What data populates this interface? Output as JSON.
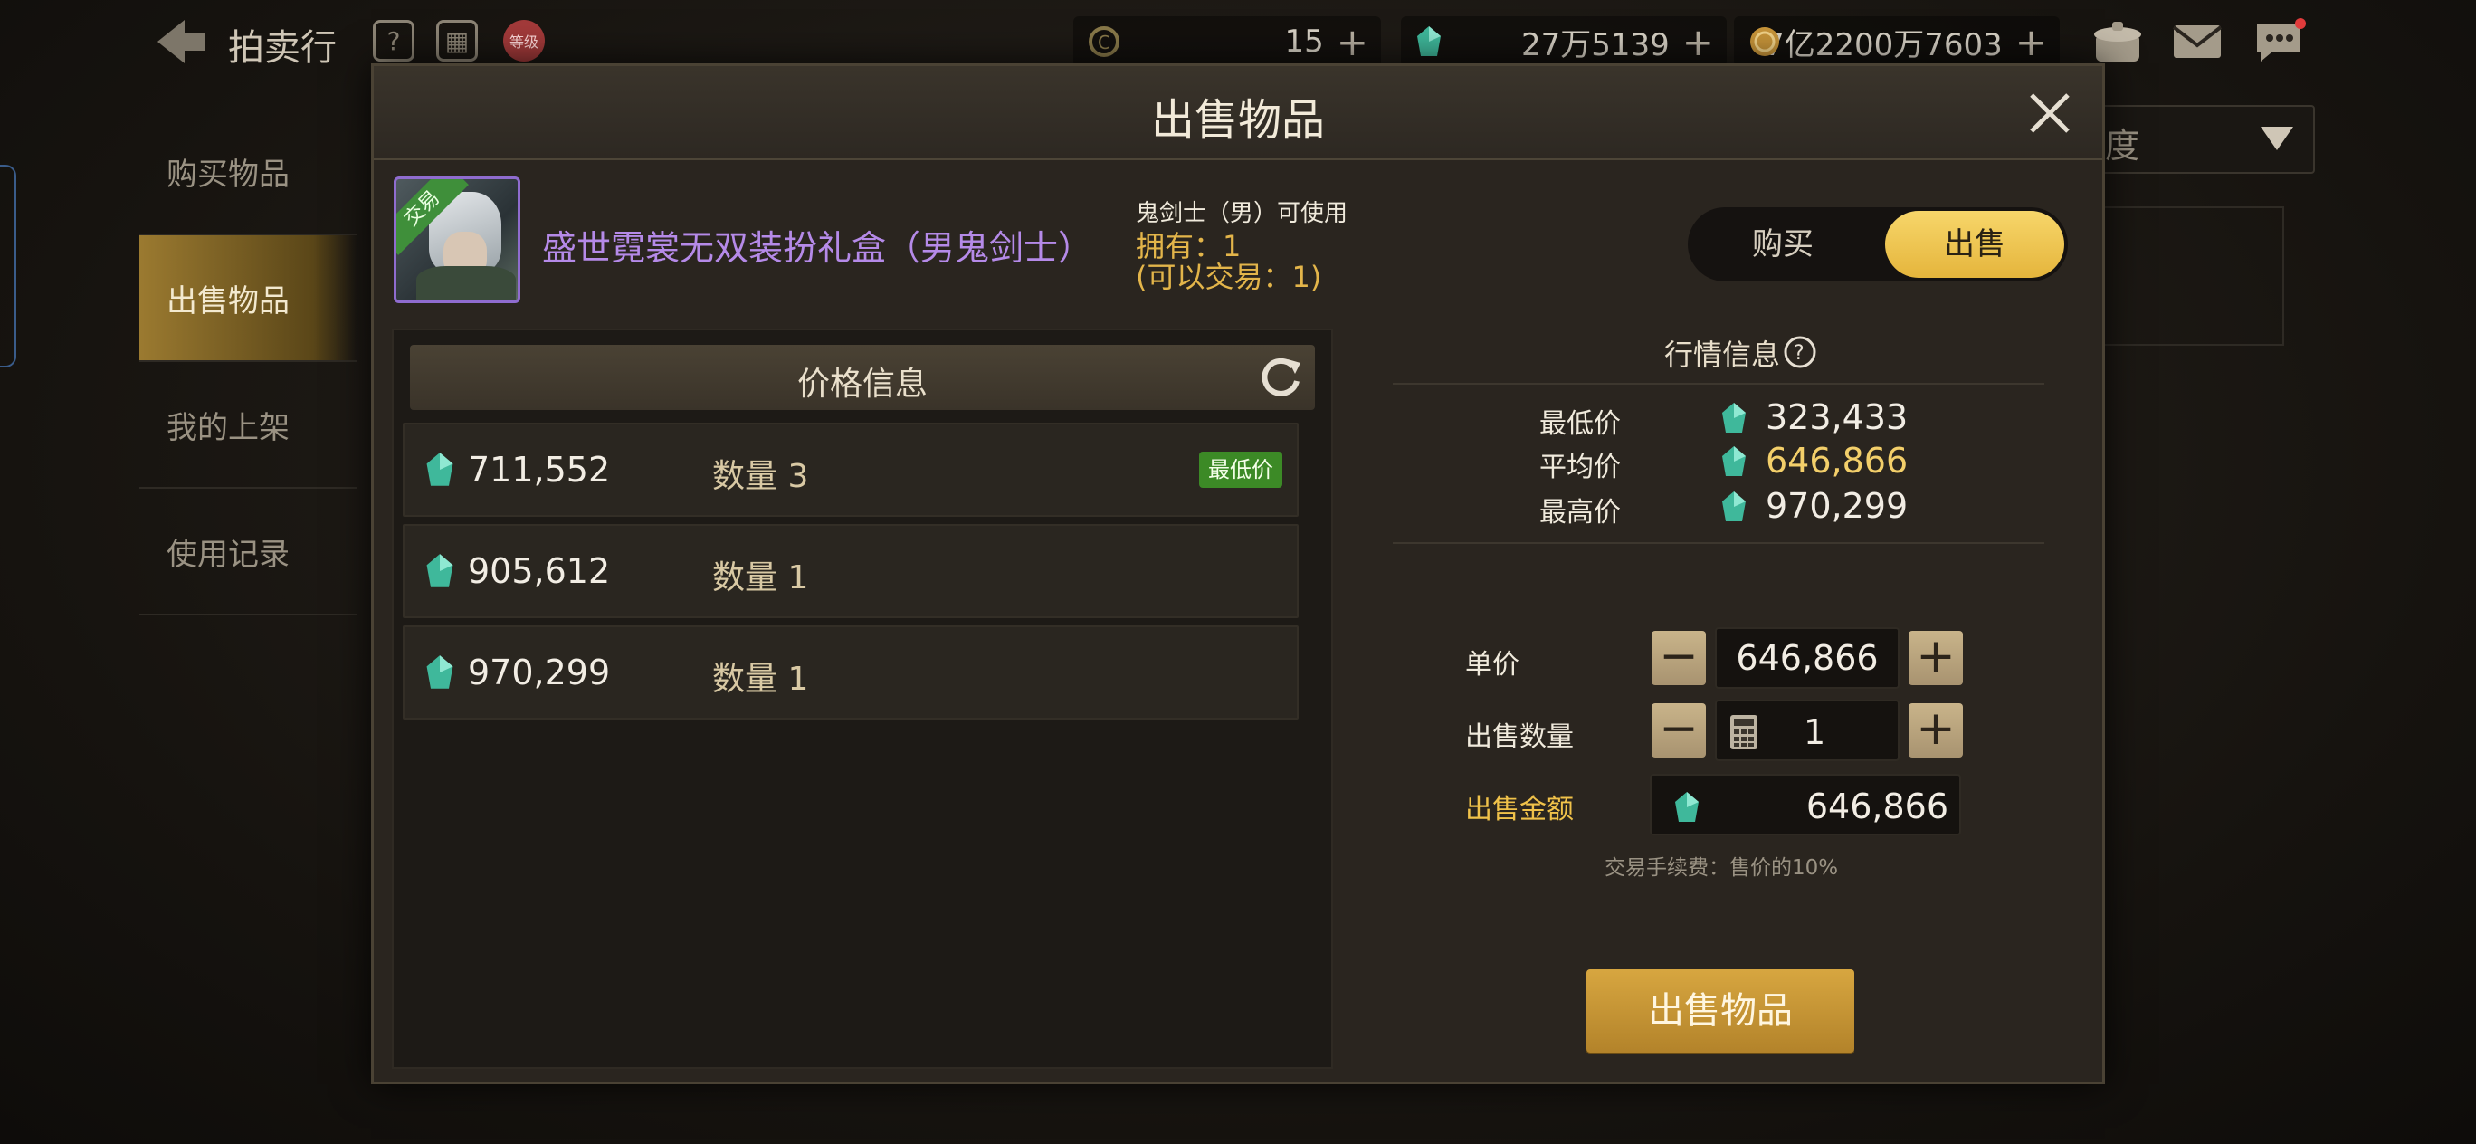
{
  "app": {
    "title": "拍卖行"
  },
  "topbar": {
    "icons": [
      "back-arrow-icon",
      "help-icon",
      "calendar-icon",
      "grade-icon"
    ],
    "grade_badge": "等级",
    "currencies": [
      {
        "name": "c-coin",
        "value": "15"
      },
      {
        "name": "gem",
        "value": "27万5139"
      },
      {
        "name": "gold",
        "value": "7亿2200万7603"
      }
    ],
    "right_icons": [
      "shop-icon",
      "mail-icon",
      "chat-icon"
    ]
  },
  "left_nav": {
    "items": [
      {
        "label": "购买物品",
        "active": false
      },
      {
        "label": "出售物品",
        "active": true
      },
      {
        "label": "我的上架",
        "active": false
      },
      {
        "label": "使用记录",
        "active": false
      }
    ]
  },
  "behind": {
    "dropdown_label": "度"
  },
  "modal": {
    "title": "出售物品",
    "item": {
      "trade_tag": "交易",
      "name": "盛世霓裳无双装扮礼盒（男鬼剑士）",
      "class_restriction": "鬼剑士（男）可使用",
      "owned": "拥有：1",
      "tradeable": "(可以交易：1)"
    },
    "mode": {
      "buy_label": "购买",
      "sell_label": "出售",
      "selected": "出售"
    },
    "price_info": {
      "title": "价格信息",
      "listings": [
        {
          "price": "711,552",
          "qty": "数量 3",
          "badge": "最低价"
        },
        {
          "price": "905,612",
          "qty": "数量 1",
          "badge": ""
        },
        {
          "price": "970,299",
          "qty": "数量 1",
          "badge": ""
        }
      ]
    },
    "market": {
      "title": "行情信息",
      "lowest_label": "最低价",
      "lowest_value": "323,433",
      "average_label": "平均价",
      "average_value": "646,866",
      "highest_label": "最高价",
      "highest_value": "970,299"
    },
    "form": {
      "unit_price_label": "单价",
      "unit_price_value": "646,866",
      "quantity_label": "出售数量",
      "quantity_value": "1",
      "total_label": "出售金额",
      "total_value": "646,866",
      "fee_note": "交易手续费：售价的10%",
      "submit_label": "出售物品"
    }
  },
  "colors": {
    "accent_gold": "#e5b53c",
    "item_name_purple": "#b58ae8",
    "lowest_badge_green": "#3c8a26",
    "average_price_yellow": "#f3cf6a"
  }
}
